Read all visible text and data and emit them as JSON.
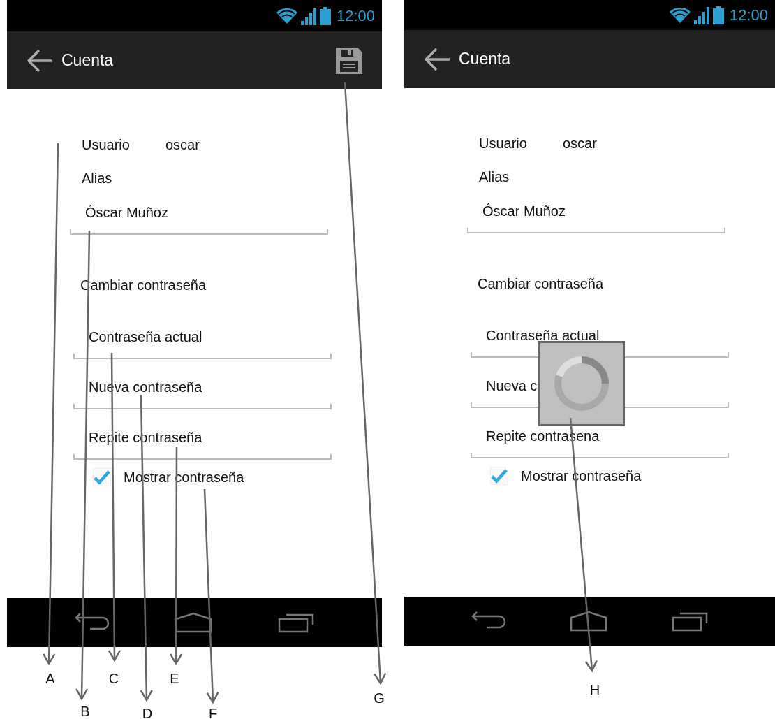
{
  "screens": [
    {
      "status_bar": {
        "time": "12:00"
      },
      "action_bar": {
        "title": "Cuenta",
        "save_action": true
      },
      "usuario": {
        "label": "Usuario",
        "value": "oscar"
      },
      "alias": {
        "label": "Alias",
        "value": "Óscar Muñoz"
      },
      "section_title": "Cambiar contraseña",
      "password_fields": [
        {
          "placeholder": "Contraseña actual"
        },
        {
          "placeholder": "Nueva contraseña"
        },
        {
          "placeholder": "Repite contraseña"
        }
      ],
      "show_password": {
        "label": "Mostrar contraseña",
        "checked": true
      },
      "loading": false
    },
    {
      "status_bar": {
        "time": "12:00"
      },
      "action_bar": {
        "title": "Cuenta",
        "save_action": false
      },
      "usuario": {
        "label": "Usuario",
        "value": "oscar"
      },
      "alias": {
        "label": "Alias",
        "value": "Óscar Muñoz"
      },
      "section_title": "Cambiar contraseña",
      "password_fields": [
        {
          "placeholder": "Contraseña actual"
        },
        {
          "placeholder": "Nueva c"
        },
        {
          "placeholder": "Repite contrasena"
        }
      ],
      "show_password": {
        "label": "Mostrar contraseña",
        "checked": true
      },
      "loading": true
    }
  ],
  "annotations": [
    {
      "label": "A"
    },
    {
      "label": "B"
    },
    {
      "label": "C"
    },
    {
      "label": "D"
    },
    {
      "label": "E"
    },
    {
      "label": "F"
    },
    {
      "label": "G"
    },
    {
      "label": "H"
    }
  ]
}
